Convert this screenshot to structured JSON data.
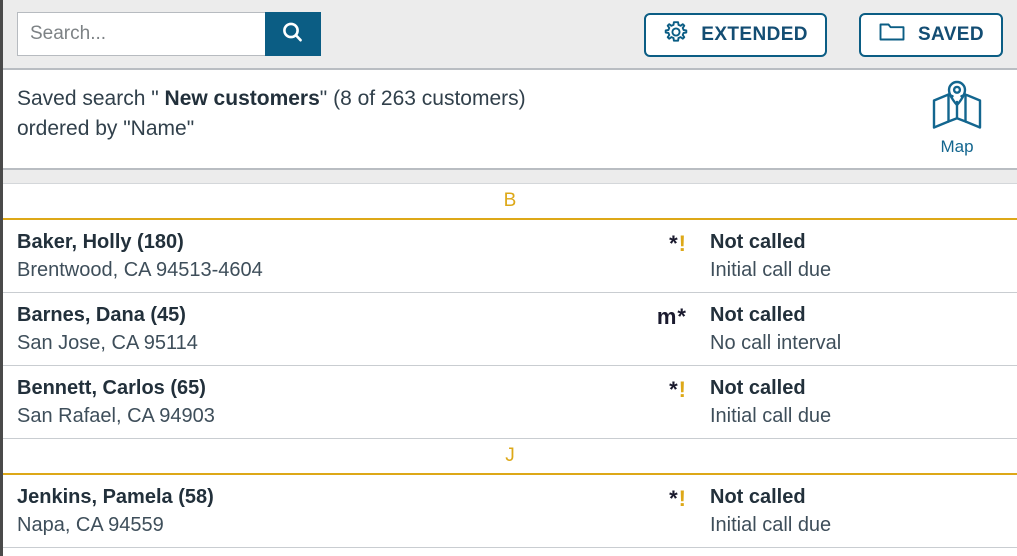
{
  "toolbar": {
    "search": {
      "placeholder": "Search...",
      "value": "",
      "button_icon": "search-icon"
    },
    "extended_button": {
      "label": "EXTENDED",
      "icon": "gear-icon"
    },
    "saved_button": {
      "label": "SAVED",
      "icon": "folder-icon"
    }
  },
  "infobar": {
    "prefix": "Saved search \" ",
    "search_name": "New customers",
    "suffix": "\" (8 of 263 customers)",
    "order_line": "ordered by \"Name\"",
    "map": {
      "label": "Map",
      "icon": "map-icon"
    }
  },
  "colors": {
    "accent_blue": "#0b5d84",
    "accent_gold": "#dda818",
    "toolbar_bg": "#ececec",
    "text_dark": "#22303b"
  },
  "list": {
    "groups": [
      {
        "letter": "B",
        "rows": [
          {
            "name": "Baker, Holly (180)",
            "address": "Brentwood, CA 94513-4604",
            "flag_primary": "*",
            "flag_warning": "!",
            "status": "Not called",
            "status_detail": "Initial call due"
          },
          {
            "name": "Barnes, Dana (45)",
            "address": "San Jose, CA 95114",
            "flag_primary": "m*",
            "flag_warning": "",
            "status": "Not called",
            "status_detail": "No call interval"
          },
          {
            "name": "Bennett, Carlos (65)",
            "address": "San Rafael, CA 94903",
            "flag_primary": "*",
            "flag_warning": "!",
            "status": "Not called",
            "status_detail": "Initial call due"
          }
        ]
      },
      {
        "letter": "J",
        "rows": [
          {
            "name": "Jenkins, Pamela (58)",
            "address": "Napa, CA 94559",
            "flag_primary": "*",
            "flag_warning": "!",
            "status": "Not called",
            "status_detail": "Initial call due"
          }
        ]
      }
    ]
  }
}
